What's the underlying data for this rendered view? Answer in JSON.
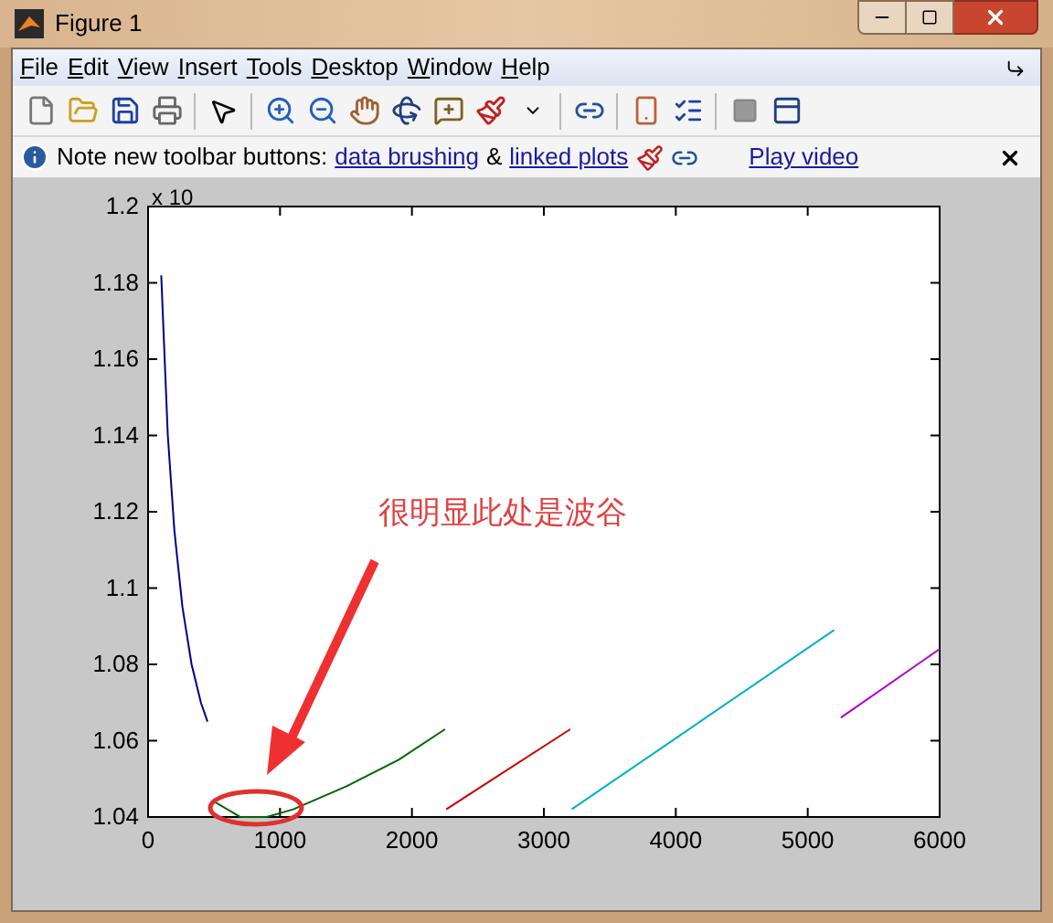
{
  "window": {
    "title": "Figure 1"
  },
  "menu": [
    "File",
    "Edit",
    "View",
    "Insert",
    "Tools",
    "Desktop",
    "Window",
    "Help"
  ],
  "info_bar": {
    "text": "Note new toolbar buttons:",
    "link_1": "data brushing",
    "separator": "&",
    "link_2": "linked plots",
    "video_link": "Play video"
  },
  "axes": {
    "exponent": "x 10",
    "chart_data": {
      "type": "line",
      "xlim": [
        0,
        6000
      ],
      "ylim": [
        1.04,
        1.2
      ],
      "xticks": [
        0,
        1000,
        2000,
        3000,
        4000,
        5000,
        6000
      ],
      "yticks": [
        1.04,
        1.06,
        1.08,
        1.1,
        1.12,
        1.14,
        1.16,
        1.18,
        1.2
      ],
      "x": [
        100,
        150,
        200,
        260,
        330,
        400,
        450,
        500,
        700,
        900,
        1100,
        1500,
        1900,
        2250,
        2260,
        3200,
        3210,
        5200,
        5250,
        6000
      ],
      "series": [
        {
          "color": "#000080",
          "values": [
            1.182,
            1.14,
            1.115,
            1.095,
            1.08,
            1.07,
            1.065,
            null,
            null,
            null,
            null,
            null,
            null,
            null,
            null,
            null,
            null,
            null,
            null,
            null
          ]
        },
        {
          "color": "#006400",
          "values": [
            null,
            null,
            null,
            null,
            null,
            null,
            null,
            1.044,
            1.04,
            1.04,
            1.042,
            1.048,
            1.055,
            1.063,
            null,
            null,
            null,
            null,
            null,
            null
          ]
        },
        {
          "color": "#cc0000",
          "values": [
            null,
            null,
            null,
            null,
            null,
            null,
            null,
            null,
            null,
            null,
            null,
            null,
            null,
            null,
            1.042,
            1.063,
            null,
            null,
            null,
            null
          ]
        },
        {
          "color": "#00b0c8",
          "values": [
            null,
            null,
            null,
            null,
            null,
            null,
            null,
            null,
            null,
            null,
            null,
            null,
            null,
            null,
            null,
            null,
            1.042,
            1.089,
            null,
            null
          ]
        },
        {
          "color": "#b000c8",
          "values": [
            null,
            null,
            null,
            null,
            null,
            null,
            null,
            null,
            null,
            null,
            null,
            null,
            null,
            null,
            null,
            null,
            null,
            null,
            1.066,
            1.084
          ]
        }
      ],
      "annotations": [
        {
          "text": "很明显此处是波谷"
        }
      ]
    }
  }
}
